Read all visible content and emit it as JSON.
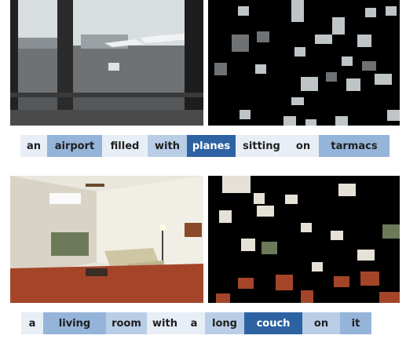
{
  "row1": {
    "caption": [
      {
        "text": "an",
        "level": 0
      },
      {
        "text": "airport",
        "level": 2
      },
      {
        "text": "filled",
        "level": 0
      },
      {
        "text": "with",
        "level": 1
      },
      {
        "text": "planes",
        "level": 3
      },
      {
        "text": "sitting",
        "level": 0
      },
      {
        "text": "on",
        "level": 0
      },
      {
        "text": "tarmacs",
        "level": 2
      }
    ]
  },
  "row2": {
    "caption": [
      {
        "text": "a",
        "level": 0
      },
      {
        "text": "living",
        "level": 2
      },
      {
        "text": "room",
        "level": 1
      },
      {
        "text": "with",
        "level": 0
      },
      {
        "text": "a",
        "level": 0
      },
      {
        "text": "long",
        "level": 1
      },
      {
        "text": "couch",
        "level": 3
      },
      {
        "text": "on",
        "level": 1
      },
      {
        "text": "it",
        "level": 2
      }
    ]
  },
  "colors": {
    "level0": "#e8eef6",
    "level1": "#b9cde6",
    "level2": "#95b4da",
    "level3": "#2d62a3"
  }
}
